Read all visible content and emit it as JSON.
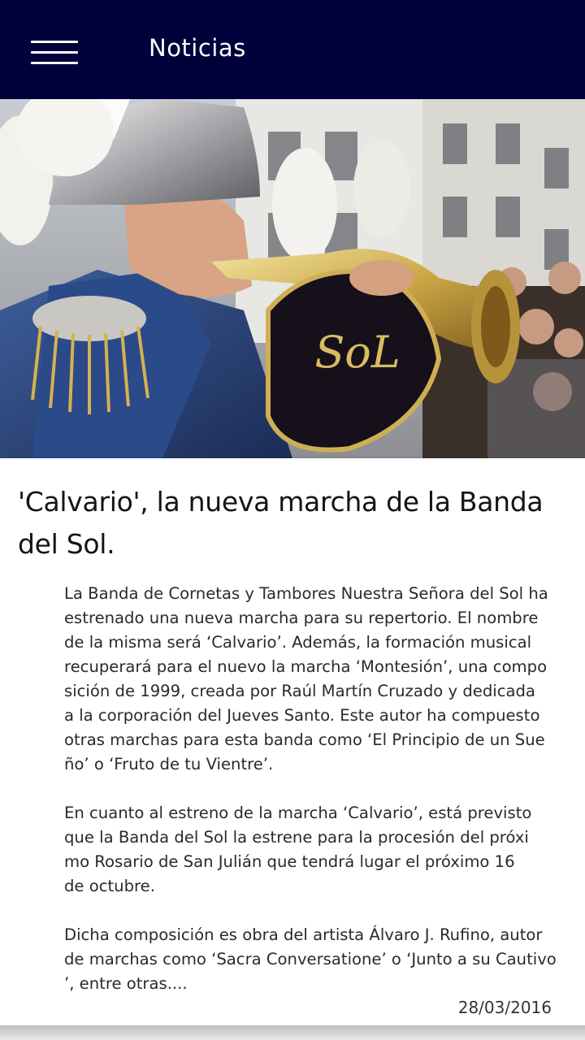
{
  "app_bar": {
    "title": "Noticias",
    "menu_icon": "hamburger-menu-icon",
    "background": "#00003b"
  },
  "article": {
    "image_banner_text": "SoL",
    "headline": "'Calvario', la nueva marcha de la Banda del Sol.",
    "paragraphs": [
      "La Banda de Cornetas y Tambores Nuestra Señora del Sol ha\nestrenado una nueva marcha para su repertorio. El nombre\nde la misma será ‘Calvario’. Además, la formación musical\nrecuperará para el nuevo la marcha ‘Montesión’, una compo\nsición de 1999, creada por Raúl Martín Cruzado y dedicada\na la corporación del Jueves Santo. Este autor ha compuesto\notras marchas para esta banda como ‘El Principio de un Sue\nño’ o ‘Fruto de tu Vientre’.",
      "En cuanto al estreno de la marcha ‘Calvario’, está previsto\nque la Banda del Sol la estrene para la procesión del próxi\nmo Rosario de San Julián que tendrá lugar el próximo 16\nde octubre.",
      "Dicha composición es obra del artista Álvaro J. Rufino, autor\nde marchas como ‘Sacra Conversatione’ o ‘Junto a su Cautivo\n’, entre otras...."
    ],
    "date": "28/03/2016"
  }
}
